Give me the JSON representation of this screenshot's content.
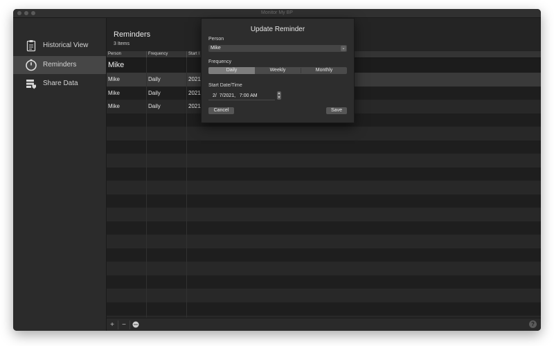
{
  "window": {
    "title": "Monitor My BP"
  },
  "sidebar": {
    "items": [
      {
        "label": "Historical View",
        "icon": "clipboard-icon",
        "selected": false
      },
      {
        "label": "Reminders",
        "icon": "timer-icon",
        "selected": true
      },
      {
        "label": "Share Data",
        "icon": "share-data-icon",
        "selected": false
      }
    ]
  },
  "main": {
    "title": "Reminders",
    "count": "3 Items",
    "columns": [
      "Person",
      "Frequency",
      "Start I"
    ],
    "edit_value": "Mike",
    "rows": [
      {
        "person": "Mike",
        "frequency": "Daily",
        "start": "2021"
      },
      {
        "person": "Mike",
        "frequency": "Daily",
        "start": "2021"
      },
      {
        "person": "Mike",
        "frequency": "Daily",
        "start": "2021"
      }
    ],
    "bottom_buttons": {
      "add": "+",
      "remove": "−",
      "more": "•"
    },
    "help": "?"
  },
  "dialog": {
    "title": "Update Reminder",
    "person_label": "Person",
    "person_value": "Mike",
    "frequency_label": "Frequency",
    "frequency_options": [
      "Daily",
      "Weekly",
      "Monthly"
    ],
    "frequency_selected": "Daily",
    "start_label": "Start Date/Time",
    "start_value": "2/  7/2021,   7:00 AM",
    "cancel_label": "Cancel",
    "save_label": "Save"
  },
  "colors": {
    "window_bg": "#242424",
    "sidebar_bg": "#2b2b2b",
    "selected_bg": "#464646",
    "segment_selected": "#7d7d7d"
  }
}
